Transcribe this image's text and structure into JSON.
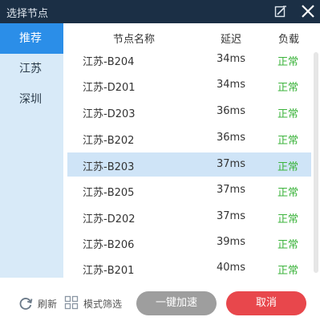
{
  "window": {
    "title": "选择节点"
  },
  "sidebar": {
    "items": [
      {
        "label": "推荐",
        "active": true
      },
      {
        "label": "江苏",
        "active": false
      },
      {
        "label": "深圳",
        "active": false
      }
    ]
  },
  "table": {
    "headers": {
      "name": "节点名称",
      "delay": "延迟",
      "load": "负载"
    },
    "rows": [
      {
        "name": "江苏-B204",
        "delay": "34ms",
        "load": "正常"
      },
      {
        "name": "江苏-D201",
        "delay": "34ms",
        "load": "正常"
      },
      {
        "name": "江苏-D203",
        "delay": "36ms",
        "load": "正常"
      },
      {
        "name": "江苏-B202",
        "delay": "36ms",
        "load": "正常"
      },
      {
        "name": "江苏-B203",
        "delay": "37ms",
        "load": "正常",
        "selected": true
      },
      {
        "name": "江苏-B205",
        "delay": "37ms",
        "load": "正常"
      },
      {
        "name": "江苏-D202",
        "delay": "37ms",
        "load": "正常"
      },
      {
        "name": "江苏-B206",
        "delay": "39ms",
        "load": "正常"
      },
      {
        "name": "江苏-B201",
        "delay": "40ms",
        "load": "正常"
      }
    ]
  },
  "footer": {
    "refresh_label": "刷新",
    "mode_filter_label": "模式筛选",
    "boost_button": "一键加速",
    "cancel_button": "取消"
  },
  "colors": {
    "titlebar": "#1b2f45",
    "sidebar_bg": "#d8eaf8",
    "sidebar_active": "#2b8ee8",
    "selected_row": "#cfe4f7",
    "load_ok": "#3bb33b",
    "boost_button": "#9e9e9e",
    "cancel_button": "#e8474c"
  },
  "icons": {
    "edit": "edit-icon",
    "close": "close-icon",
    "refresh": "refresh-icon",
    "mode_filter": "grid-icon"
  }
}
